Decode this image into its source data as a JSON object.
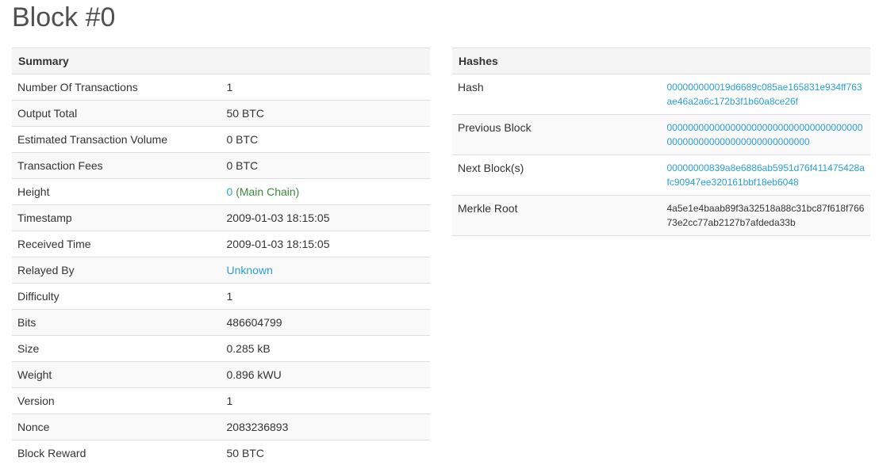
{
  "page": {
    "title": "Block #0"
  },
  "summary": {
    "header": "Summary",
    "rows": {
      "num_tx": {
        "label": "Number Of Transactions",
        "value": "1"
      },
      "output_total": {
        "label": "Output Total",
        "value": "50 BTC"
      },
      "est_volume": {
        "label": "Estimated Transaction Volume",
        "value": "0 BTC"
      },
      "fees": {
        "label": "Transaction Fees",
        "value": "0 BTC"
      },
      "height": {
        "label": "Height",
        "value": "0",
        "chain": "(Main Chain)"
      },
      "timestamp": {
        "label": "Timestamp",
        "value": "2009-01-03 18:15:05"
      },
      "received": {
        "label": "Received Time",
        "value": "2009-01-03 18:15:05"
      },
      "relayed_by": {
        "label": "Relayed By",
        "value": "Unknown"
      },
      "difficulty": {
        "label": "Difficulty",
        "value": "1"
      },
      "bits": {
        "label": "Bits",
        "value": "486604799"
      },
      "size": {
        "label": "Size",
        "value": "0.285 kB"
      },
      "weight": {
        "label": "Weight",
        "value": "0.896 kWU"
      },
      "version": {
        "label": "Version",
        "value": "1"
      },
      "nonce": {
        "label": "Nonce",
        "value": "2083236893"
      },
      "reward": {
        "label": "Block Reward",
        "value": "50 BTC"
      }
    }
  },
  "hashes": {
    "header": "Hashes",
    "rows": {
      "hash": {
        "label": "Hash",
        "value": "000000000019d6689c085ae165831e934ff763ae46a2a6c172b3f1b60a8ce26f"
      },
      "previous": {
        "label": "Previous Block",
        "value": "0000000000000000000000000000000000000000000000000000000000000000"
      },
      "next": {
        "label": "Next Block(s)",
        "value": "00000000839a8e6886ab5951d76f411475428afc90947ee320161bbf18eb6048"
      },
      "merkle": {
        "label": "Merkle Root",
        "value": "4a5e1e4baab89f3a32518a88c31bc87f618f76673e2cc77ab2127b7afdeda33b"
      }
    }
  },
  "colors": {
    "link": "#2a9fd6",
    "main_chain": "#3a8a3a",
    "header_bg": "#f5f5f5",
    "border": "#dddddd"
  }
}
